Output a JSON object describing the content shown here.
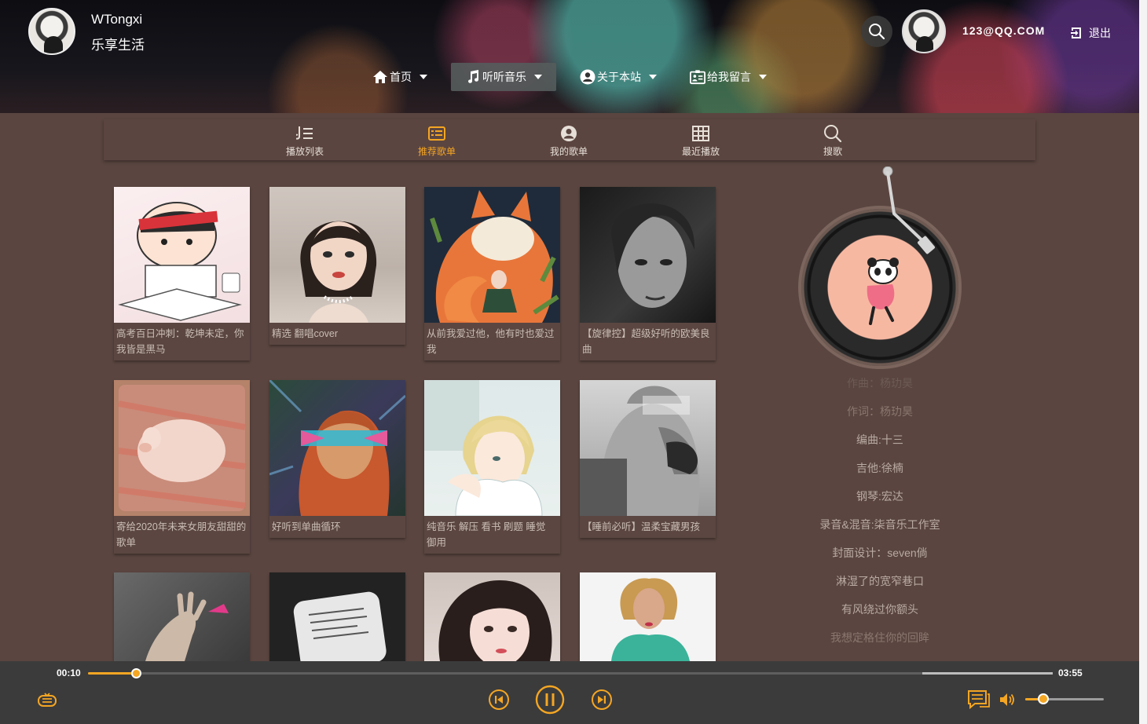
{
  "brand": {
    "name": "WTongxi",
    "slogan": "乐享生活"
  },
  "nav": [
    {
      "label": "首页",
      "icon": "home-icon"
    },
    {
      "label": "听听音乐",
      "icon": "music-note-icon"
    },
    {
      "label": "关于本站",
      "icon": "user-circle-icon"
    },
    {
      "label": "给我留言",
      "icon": "message-board-icon"
    }
  ],
  "user": {
    "email": "123@QQ.COM",
    "logout_label": "退出"
  },
  "subtabs": [
    {
      "label": "播放列表",
      "icon": "playlist-icon"
    },
    {
      "label": "推荐歌单",
      "icon": "recommend-list-icon"
    },
    {
      "label": "我的歌单",
      "icon": "my-list-icon"
    },
    {
      "label": "最近播放",
      "icon": "recent-grid-icon"
    },
    {
      "label": "搜歌",
      "icon": "search-icon"
    }
  ],
  "playlists": [
    {
      "title": "高考百日冲刺：乾坤未定，你我皆是黑马"
    },
    {
      "title": "精选 翻唱cover"
    },
    {
      "title": "从前我爱过他，他有时也爱过我"
    },
    {
      "title": "【旋律控】超级好听的欧美良曲"
    },
    {
      "title": "寄给2020年未来女朋友甜甜的歌单"
    },
    {
      "title": "好听到单曲循环"
    },
    {
      "title": "纯音乐 解压 看书 刷题 睡觉 御用"
    },
    {
      "title": "【睡前必听】温柔宝藏男孩"
    },
    {
      "title": ""
    },
    {
      "title": ""
    },
    {
      "title": ""
    },
    {
      "title": ""
    }
  ],
  "lyrics": [
    "作曲：杨玏昊",
    "作词：杨玏昊",
    "编曲:十三",
    "吉他:徐楠",
    "钢琴:宏达",
    "录音&混音:柒音乐工作室",
    "封面设计：seven倘",
    "淋湿了的宽窄巷口",
    "有风绕过你额头",
    "我想定格住你的回眸"
  ],
  "player": {
    "current_time": "00:10",
    "total_time": "03:55",
    "progress": 0.05,
    "buffered_start": 0.865,
    "volume": 0.23
  },
  "colors": {
    "accent": "#f5a623",
    "background": "#5a4540",
    "player_bar": "#3b3b3b"
  }
}
